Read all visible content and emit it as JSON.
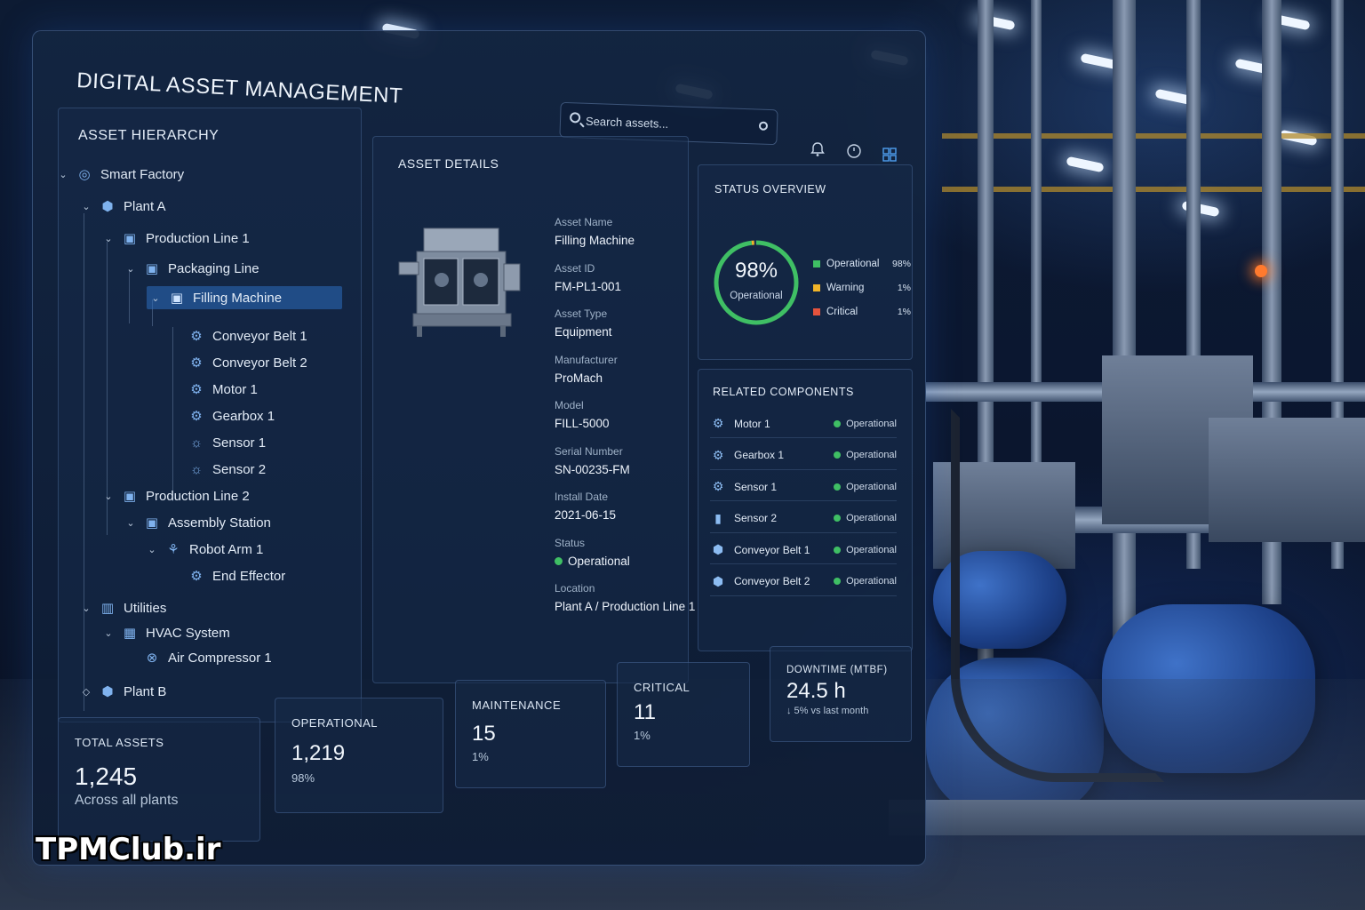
{
  "app": {
    "title": "DIGITAL ASSET MANAGEMENT"
  },
  "search": {
    "placeholder": "Search assets..."
  },
  "toolbar": {
    "icons": [
      "bell-icon",
      "clock-icon",
      "grid-icon"
    ]
  },
  "hierarchy": {
    "title": "ASSET HIERARCHY",
    "items": [
      {
        "label": "Smart Factory",
        "icon": "factory-icon"
      },
      {
        "label": "Plant A",
        "icon": "plant-icon"
      },
      {
        "label": "Production Line 1",
        "icon": "line-icon"
      },
      {
        "label": "Packaging Line",
        "icon": "line-icon"
      },
      {
        "label": "Filling Machine",
        "icon": "machine-icon",
        "selected": true
      },
      {
        "label": "Conveyor Belt 1",
        "icon": "gear-icon"
      },
      {
        "label": "Conveyor Belt 2",
        "icon": "gear-icon"
      },
      {
        "label": "Motor 1",
        "icon": "gear-icon"
      },
      {
        "label": "Gearbox 1",
        "icon": "gear-icon"
      },
      {
        "label": "Sensor 1",
        "icon": "sensor-icon"
      },
      {
        "label": "Sensor 2",
        "icon": "sensor-icon"
      },
      {
        "label": "Production Line 2",
        "icon": "line-icon"
      },
      {
        "label": "Assembly Station",
        "icon": "line-icon"
      },
      {
        "label": "Robot Arm 1",
        "icon": "robot-arm-icon"
      },
      {
        "label": "End Effector",
        "icon": "gear-icon"
      },
      {
        "label": "Utilities",
        "icon": "utilities-icon"
      },
      {
        "label": "HVAC System",
        "icon": "hvac-icon"
      },
      {
        "label": "Air Compressor 1",
        "icon": "compressor-icon"
      },
      {
        "label": "Plant B",
        "icon": "plant-icon"
      }
    ]
  },
  "details": {
    "title": "ASSET DETAILS",
    "fields": [
      {
        "label": "Asset Name",
        "value": "Filling Machine"
      },
      {
        "label": "Asset ID",
        "value": "FM-PL1-001"
      },
      {
        "label": "Asset Type",
        "value": "Equipment"
      },
      {
        "label": "Manufacturer",
        "value": "ProMach"
      },
      {
        "label": "Model",
        "value": "FILL-5000"
      },
      {
        "label": "Serial Number",
        "value": "SN-00235-FM"
      },
      {
        "label": "Install Date",
        "value": "2021-06-15"
      },
      {
        "label": "Status",
        "value": "Operational"
      },
      {
        "label": "Location",
        "value": "Plant A / Production Line 1"
      }
    ]
  },
  "status_overview": {
    "title": "STATUS OVERVIEW",
    "center_value": "98%",
    "center_label": "Operational",
    "legend": [
      {
        "label": "Operational",
        "value": "98%",
        "color": "#3fbf64"
      },
      {
        "label": "Warning",
        "value": "1%",
        "color": "#f0b429"
      },
      {
        "label": "Critical",
        "value": "1%",
        "color": "#e5533d"
      }
    ],
    "operational_fraction": 0.98
  },
  "related": {
    "title": "RELATED COMPONENTS",
    "items": [
      {
        "name": "Motor 1",
        "status": "Operational",
        "icon": "gear-icon"
      },
      {
        "name": "Gearbox 1",
        "status": "Operational",
        "icon": "gear-icon"
      },
      {
        "name": "Sensor 1",
        "status": "Operational",
        "icon": "gear-icon"
      },
      {
        "name": "Sensor 2",
        "status": "Operational",
        "icon": "sensor-icon"
      },
      {
        "name": "Conveyor Belt 1",
        "status": "Operational",
        "icon": "conveyor-icon"
      },
      {
        "name": "Conveyor Belt 2",
        "status": "Operational",
        "icon": "conveyor-icon"
      }
    ]
  },
  "kpis": [
    {
      "label": "TOTAL ASSETS",
      "value": "1,245",
      "sub": "Across all plants"
    },
    {
      "label": "OPERATIONAL",
      "value": "1,219",
      "sub": "98%"
    },
    {
      "label": "MAINTENANCE",
      "value": "15",
      "sub": "1%"
    },
    {
      "label": "CRITICAL",
      "value": "11",
      "sub": "1%"
    },
    {
      "label": "DOWNTIME (MTBF)",
      "value": "24.5 h",
      "sub": "↓ 5% vs last month"
    }
  ],
  "watermark": "TPMClub.ir"
}
